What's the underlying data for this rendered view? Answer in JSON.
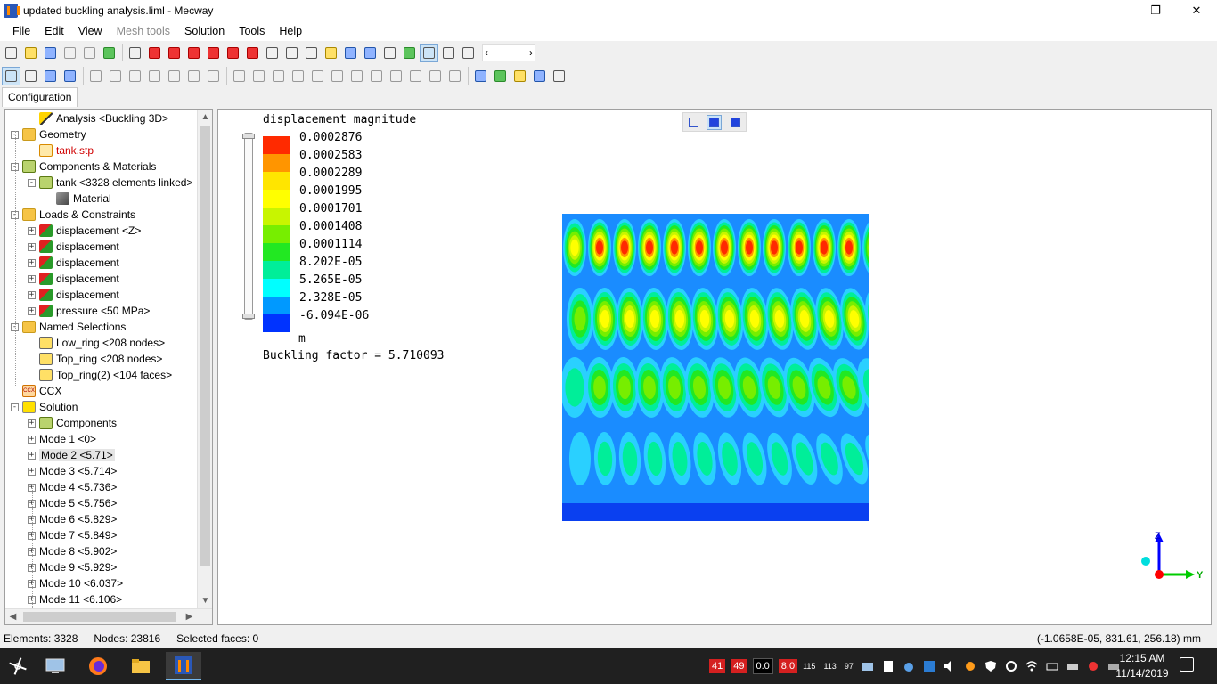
{
  "window": {
    "title": "updated buckling analysis.liml - Mecway",
    "minimize_glyph": "—",
    "maximize_glyph": "❐",
    "close_glyph": "✕"
  },
  "menu": [
    {
      "label": "File",
      "enabled": true
    },
    {
      "label": "Edit",
      "enabled": true
    },
    {
      "label": "View",
      "enabled": true
    },
    {
      "label": "Mesh tools",
      "enabled": false
    },
    {
      "label": "Solution",
      "enabled": true
    },
    {
      "label": "Tools",
      "enabled": true
    },
    {
      "label": "Help",
      "enabled": true
    }
  ],
  "tabs": {
    "configuration": "Configuration"
  },
  "tree": {
    "nodes": [
      {
        "label": "Analysis <Buckling 3D>",
        "icon": "analysis-icon"
      },
      {
        "label": "Geometry",
        "icon": "folder-icon"
      },
      {
        "label": "tank.stp",
        "icon": "file-icon"
      },
      {
        "label": "Components & Materials",
        "icon": "components-icon"
      },
      {
        "label": "tank <3328 elements linked>",
        "icon": "component-icon"
      },
      {
        "label": "Material",
        "icon": "material-icon"
      },
      {
        "label": "Loads & Constraints",
        "icon": "folder-icon"
      },
      {
        "label": "displacement <Z>",
        "icon": "displacement-icon"
      },
      {
        "label": "displacement",
        "icon": "displacement-icon"
      },
      {
        "label": "displacement",
        "icon": "displacement-icon"
      },
      {
        "label": "displacement",
        "icon": "displacement-icon"
      },
      {
        "label": "displacement",
        "icon": "displacement-icon"
      },
      {
        "label": "pressure <50 MPa>",
        "icon": "pressure-icon"
      },
      {
        "label": "Named Selections",
        "icon": "folder-icon"
      },
      {
        "label": "Low_ring <208 nodes>",
        "icon": "selection-icon"
      },
      {
        "label": "Top_ring <208 nodes>",
        "icon": "selection-icon"
      },
      {
        "label": "Top_ring(2) <104 faces>",
        "icon": "selection-icon"
      },
      {
        "label": "CCX",
        "icon": "ccx-icon",
        "icon_text": "CCX"
      },
      {
        "label": "Solution",
        "icon": "solution-icon"
      },
      {
        "label": "Components",
        "icon": "components-icon"
      },
      {
        "label": "Mode 1 <0>"
      },
      {
        "label": "Mode 2 <5.71>"
      },
      {
        "label": "Mode 3 <5.714>"
      },
      {
        "label": "Mode 4 <5.736>"
      },
      {
        "label": "Mode 5 <5.756>"
      },
      {
        "label": "Mode 6 <5.829>"
      },
      {
        "label": "Mode 7 <5.849>"
      },
      {
        "label": "Mode 8 <5.902>"
      },
      {
        "label": "Mode 9 <5.929>"
      },
      {
        "label": "Mode 10 <6.037>"
      },
      {
        "label": "Mode 11 <6.106>"
      }
    ],
    "selected_label": "Mode 2 <5.71>",
    "red_label": "tank.stp"
  },
  "legend": {
    "title": "displacement magnitude",
    "values": [
      "0.0002876",
      "0.0002583",
      "0.0002289",
      "0.0001995",
      "0.0001701",
      "0.0001408",
      "0.0001114",
      "8.202E-05",
      "5.265E-05",
      "2.328E-05",
      "-6.094E-06"
    ],
    "colors": [
      "#ff2a00",
      "#ff9500",
      "#ffe500",
      "#ffff00",
      "#c8f500",
      "#77ee00",
      "#22e822",
      "#00ee99",
      "#00ffff",
      "#0099ff",
      "#0033ff"
    ],
    "unit": "m",
    "buckling_factor": "Buckling factor = 5.710093"
  },
  "triad": {
    "z": "Z",
    "y": "Y"
  },
  "status": {
    "elements": "Elements: 3328",
    "nodes": "Nodes: 23816",
    "faces": "Selected faces: 0",
    "coords": "(-1.0658E-05, 831.61, 256.18) mm"
  },
  "taskbar": {
    "tray_badges": [
      {
        "text": "41",
        "style": "red"
      },
      {
        "text": "49",
        "style": "red"
      },
      {
        "text": "0.0",
        "style": "black"
      },
      {
        "text": "8.0",
        "style": "red"
      }
    ],
    "tray_texts": [
      "115",
      "113",
      "97"
    ],
    "clock_time": "12:15 AM",
    "clock_date": "11/14/2019"
  }
}
